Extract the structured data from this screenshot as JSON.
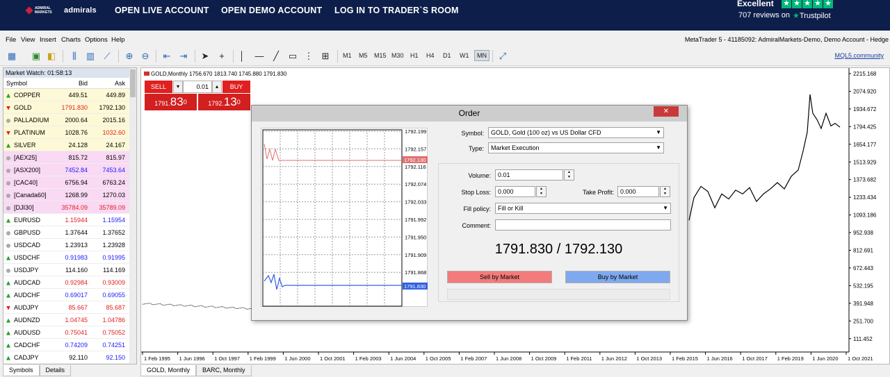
{
  "site": {
    "logo_small": "ADMIRAL MARKETS",
    "logo_text": "admirals",
    "nav": [
      "OPEN LIVE ACCOUNT",
      "OPEN DEMO ACCOUNT",
      "LOG IN TO TRADER`S ROOM"
    ],
    "trustpilot": {
      "rating_word": "Excellent",
      "reviews": "707 reviews on",
      "brand": "Trustpilot",
      "stars": 5,
      "color": "#00b67a"
    }
  },
  "menubar": {
    "items": [
      "File",
      "View",
      "Insert",
      "Charts",
      "Options",
      "Help"
    ],
    "account": "MetaTrader 5 - 41185092: AdmiralMarkets-Demo, Demo Account - Hedge"
  },
  "toolbar": {
    "timeframes": [
      "M1",
      "M5",
      "M15",
      "M30",
      "H1",
      "H4",
      "D1",
      "W1",
      "MN"
    ],
    "active_timeframe": "MN",
    "community_link": "MQL5.community",
    "icons": [
      "new-chart-icon",
      "new-order-icon",
      "bar-chart-icon",
      "candle-chart-icon",
      "line-chart-icon",
      "zoom-in-icon",
      "zoom-out-icon",
      "autoscroll-icon",
      "chart-shift-icon",
      "cursor-icon",
      "crosshair-icon",
      "vertical-line-icon",
      "horizontal-line-icon",
      "trendline-icon",
      "text-icon",
      "fibo-icon",
      "fullscreen-icon"
    ]
  },
  "market_watch": {
    "title": "Market Watch: 01:58:13",
    "columns": [
      "Symbol",
      "Bid",
      "Ask"
    ],
    "rows": [
      {
        "symbol": "COPPER",
        "bid": "449.51",
        "ask": "449.89",
        "dir": "up",
        "bg": "#fdf9d6",
        "bidc": "nu",
        "askc": "nu"
      },
      {
        "symbol": "GOLD",
        "bid": "1791.830",
        "ask": "1792.130",
        "dir": "dn",
        "bg": "#fdf9d6",
        "bidc": "dn",
        "askc": "nu"
      },
      {
        "symbol": "PALLADIUM",
        "bid": "2000.64",
        "ask": "2015.16",
        "dir": "nu",
        "bg": "#fdf9d6",
        "bidc": "nu",
        "askc": "nu"
      },
      {
        "symbol": "PLATINUM",
        "bid": "1028.76",
        "ask": "1032.60",
        "dir": "dn",
        "bg": "#fdf9d6",
        "bidc": "nu",
        "askc": "dn"
      },
      {
        "symbol": "SILVER",
        "bid": "24.128",
        "ask": "24.167",
        "dir": "up",
        "bg": "#fdf9d6",
        "bidc": "nu",
        "askc": "nu"
      },
      {
        "symbol": "[AEX25]",
        "bid": "815.72",
        "ask": "815.97",
        "dir": "nu",
        "bg": "#f9d9f3",
        "bidc": "nu",
        "askc": "nu"
      },
      {
        "symbol": "[ASX200]",
        "bid": "7452.84",
        "ask": "7453.64",
        "dir": "nu",
        "bg": "#f9d9f3",
        "bidc": "up",
        "askc": "up"
      },
      {
        "symbol": "[CAC40]",
        "bid": "6756.94",
        "ask": "6763.24",
        "dir": "nu",
        "bg": "#f9d9f3",
        "bidc": "nu",
        "askc": "nu"
      },
      {
        "symbol": "[Canada60]",
        "bid": "1268.99",
        "ask": "1270.03",
        "dir": "nu",
        "bg": "#f9d9f3",
        "bidc": "nu",
        "askc": "nu"
      },
      {
        "symbol": "[DJI30]",
        "bid": "35784.09",
        "ask": "35789.09",
        "dir": "nu",
        "bg": "#f9d9f3",
        "bidc": "dn",
        "askc": "dn"
      },
      {
        "symbol": "EURUSD",
        "bid": "1.15944",
        "ask": "1.15954",
        "dir": "up",
        "bg": "#ffffff",
        "bidc": "dn",
        "askc": "up"
      },
      {
        "symbol": "GBPUSD",
        "bid": "1.37644",
        "ask": "1.37652",
        "dir": "nu",
        "bg": "#ffffff",
        "bidc": "nu",
        "askc": "nu"
      },
      {
        "symbol": "USDCAD",
        "bid": "1.23913",
        "ask": "1.23928",
        "dir": "nu",
        "bg": "#ffffff",
        "bidc": "nu",
        "askc": "nu"
      },
      {
        "symbol": "USDCHF",
        "bid": "0.91983",
        "ask": "0.91995",
        "dir": "up",
        "bg": "#ffffff",
        "bidc": "up",
        "askc": "up"
      },
      {
        "symbol": "USDJPY",
        "bid": "114.160",
        "ask": "114.169",
        "dir": "nu",
        "bg": "#ffffff",
        "bidc": "nu",
        "askc": "nu"
      },
      {
        "symbol": "AUDCAD",
        "bid": "0.92984",
        "ask": "0.93009",
        "dir": "up",
        "bg": "#ffffff",
        "bidc": "dn",
        "askc": "dn"
      },
      {
        "symbol": "AUDCHF",
        "bid": "0.69017",
        "ask": "0.69055",
        "dir": "up",
        "bg": "#ffffff",
        "bidc": "up",
        "askc": "up"
      },
      {
        "symbol": "AUDJPY",
        "bid": "85.667",
        "ask": "85.687",
        "dir": "dn",
        "bg": "#ffffff",
        "bidc": "dn",
        "askc": "dn"
      },
      {
        "symbol": "AUDNZD",
        "bid": "1.04745",
        "ask": "1.04786",
        "dir": "up",
        "bg": "#ffffff",
        "bidc": "dn",
        "askc": "dn"
      },
      {
        "symbol": "AUDUSD",
        "bid": "0.75041",
        "ask": "0.75052",
        "dir": "up",
        "bg": "#ffffff",
        "bidc": "dn",
        "askc": "dn"
      },
      {
        "symbol": "CADCHF",
        "bid": "0.74209",
        "ask": "0.74251",
        "dir": "up",
        "bg": "#ffffff",
        "bidc": "up",
        "askc": "up"
      },
      {
        "symbol": "CADJPY",
        "bid": "92.110",
        "ask": "92.150",
        "dir": "up",
        "bg": "#ffffff",
        "bidc": "nu",
        "askc": "up"
      }
    ],
    "tabs": [
      "Symbols",
      "Details"
    ]
  },
  "chart": {
    "info": "GOLD,Monthly  1756.670 1813.740 1745.880 1791.830",
    "sell_label": "SELL",
    "buy_label": "BUY",
    "volume": "0.01",
    "sell_price_small": "1791.",
    "sell_price_big": "83",
    "sell_price_sup": "0",
    "buy_price_small": "1792.",
    "buy_price_big": "13",
    "buy_price_sup": "0",
    "tabs": [
      "GOLD, Monthly",
      "BARC, Monthly"
    ],
    "y_labels": [
      "2215.168",
      "2074.920",
      "1934.672",
      "1794.425",
      "1654.177",
      "1513.929",
      "1373.682",
      "1233.434",
      "1093.186",
      "952.938",
      "812.691",
      "672.443",
      "532.195",
      "391.948",
      "251.700",
      "111.452"
    ],
    "x_labels": [
      "1 Feb 1995",
      "1 Jun 1996",
      "1 Oct 1997",
      "1 Feb 1999",
      "1 Jun 2000",
      "1 Oct 2001",
      "1 Feb 2003",
      "1 Jun 2004",
      "1 Oct 2005",
      "1 Feb 2007",
      "1 Jun 2008",
      "1 Oct 2009",
      "1 Feb 2011",
      "1 Jun 2012",
      "1 Oct 2013",
      "1 Feb 2015",
      "1 Jun 2016",
      "1 Oct 2017",
      "1 Feb 2019",
      "1 Jun 2020",
      "1 Oct 2021"
    ]
  },
  "order": {
    "title": "Order",
    "symbol_label": "Symbol:",
    "symbol_value": "GOLD, Gold (100 oz) vs US Dollar CFD",
    "type_label": "Type:",
    "type_value": "Market Execution",
    "volume_label": "Volume:",
    "volume_value": "0.01",
    "sl_label": "Stop Loss:",
    "sl_value": "0.000",
    "tp_label": "Take Profit:",
    "tp_value": "0.000",
    "fill_label": "Fill policy:",
    "fill_value": "Fill or Kill",
    "comment_label": "Comment:",
    "comment_value": "",
    "price": "1791.830 / 1792.130",
    "sell_btn": "Sell by Market",
    "buy_btn": "Buy by Market",
    "mini_labels": [
      "1792.199",
      "1792.157",
      "1792.116",
      "1792.074",
      "1792.033",
      "1791.992",
      "1791.950",
      "1791.909",
      "1791.868"
    ],
    "ask_tag": "1792.130",
    "bid_tag": "1791.830"
  }
}
